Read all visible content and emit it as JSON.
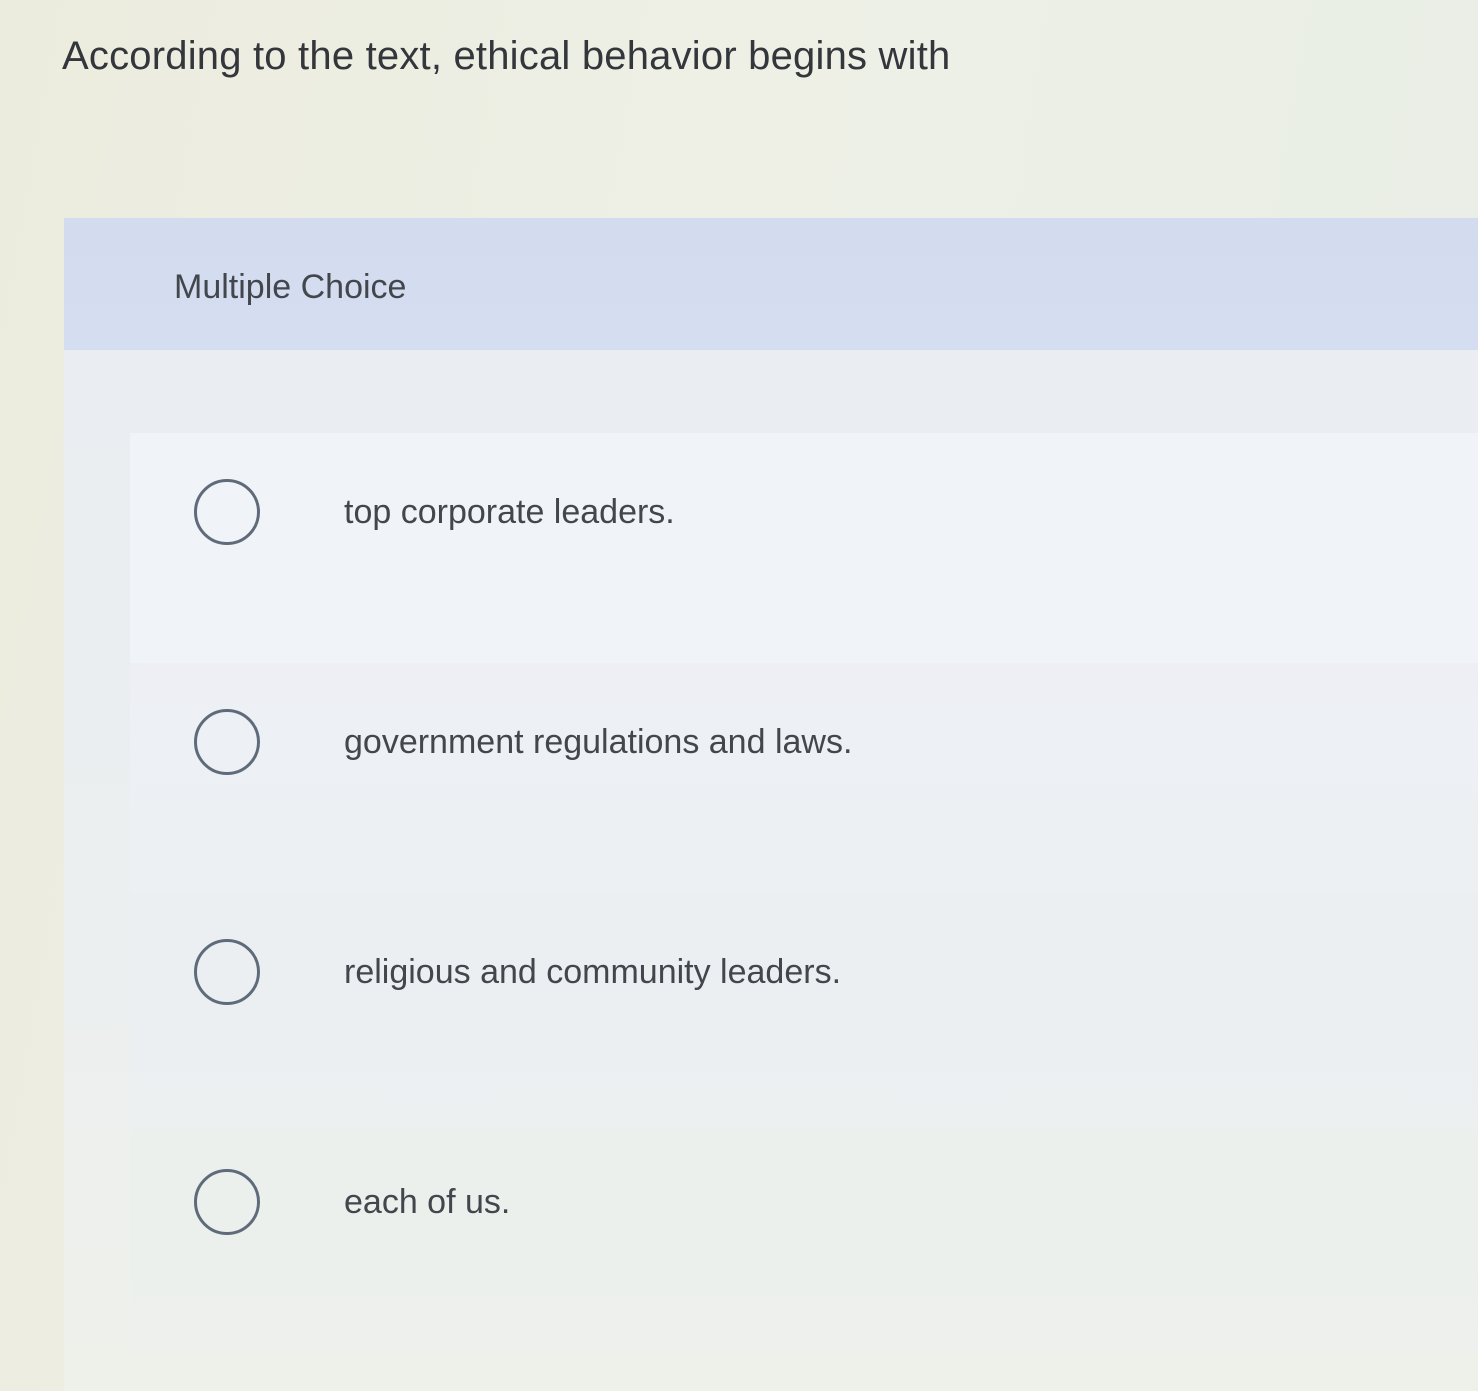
{
  "question": {
    "text": "According to the text, ethical behavior begins with"
  },
  "panel": {
    "type_label": "Multiple Choice"
  },
  "options": [
    {
      "label": "top corporate leaders.",
      "selected": false
    },
    {
      "label": "government regulations and laws.",
      "selected": false
    },
    {
      "label": "religious and community leaders.",
      "selected": false
    },
    {
      "label": "each of us.",
      "selected": false
    }
  ]
}
